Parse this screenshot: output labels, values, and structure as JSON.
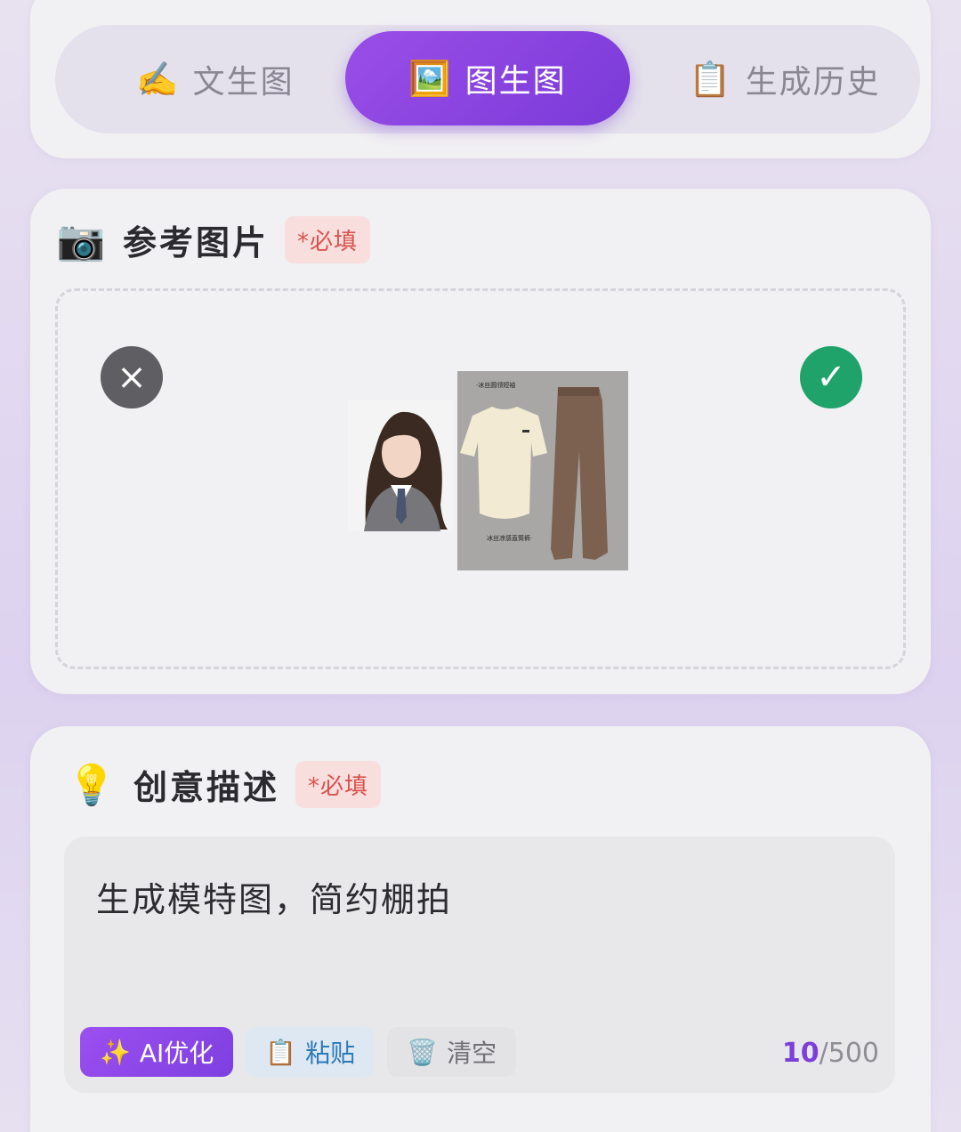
{
  "tabs": [
    {
      "icon": "✍️",
      "label": "文生图",
      "active": false
    },
    {
      "icon": "🖼️",
      "label": "图生图",
      "active": true
    },
    {
      "icon": "📋",
      "label": "生成历史",
      "active": false
    }
  ],
  "reference": {
    "icon": "📷",
    "title": "参考图片",
    "required": "*必填",
    "remove_icon": "×",
    "confirm_icon": "✓",
    "preview": {
      "top_tag": "·冰丝圆领短袖",
      "bottom_tag": "冰丝凉感直筒裤·"
    }
  },
  "description": {
    "icon": "💡",
    "title": "创意描述",
    "required": "*必填",
    "text": "生成模特图，简约棚拍",
    "buttons": {
      "ai": {
        "icon": "✨",
        "label": "AI优化"
      },
      "paste": {
        "icon": "📋",
        "label": "粘贴"
      },
      "clear": {
        "icon": "🗑️",
        "label": "清空"
      }
    },
    "count_current": "10",
    "count_max": "/500"
  },
  "colors": {
    "accent": "#8a44e4",
    "success": "#1fa36a",
    "required": "#d9534f"
  }
}
